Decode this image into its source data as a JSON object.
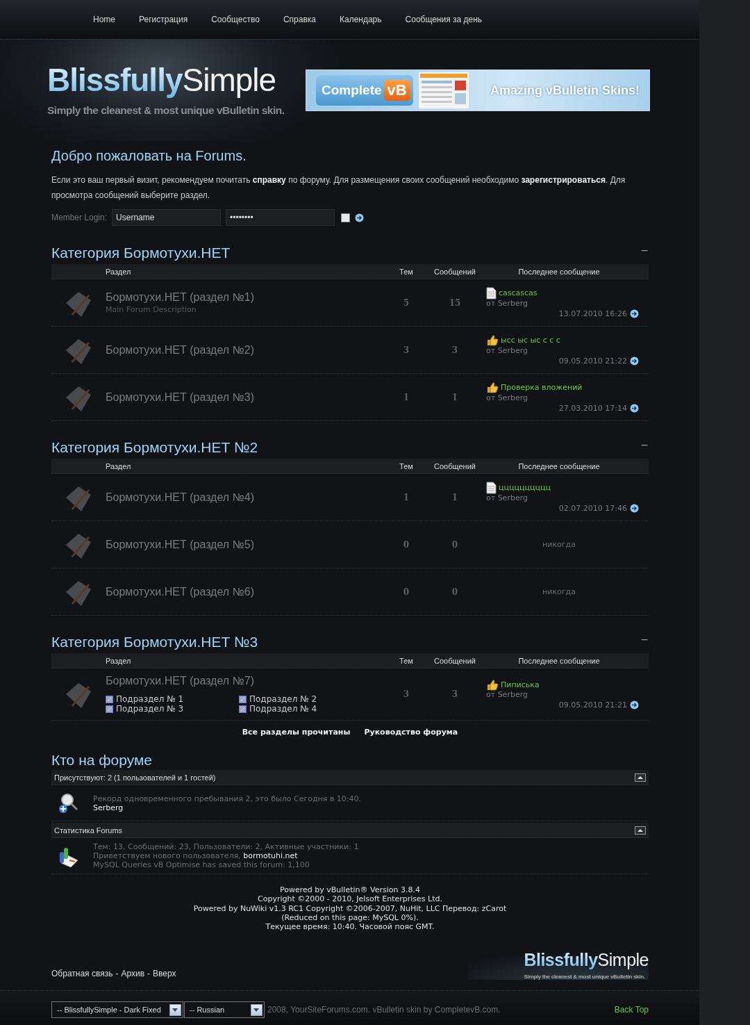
{
  "nav": [
    "Home",
    "Регистрация",
    "Сообщество",
    "Справка",
    "Календарь",
    "Сообщения за день"
  ],
  "logo": {
    "bold": "Blissfully",
    "light": "Simple",
    "tagline": "Simply the cleanest & most unique vBulletin skin."
  },
  "banner": {
    "left": "Complete",
    "badge": "vB",
    "right": "Amazing vBulletin Skins!"
  },
  "welcome": {
    "title": "Добро пожаловать на Forums.",
    "text": "Если это ваш первый визит, рекомендуем почитать **справку** по форуму. Для размещения своих сообщений необходимо **зарегистрироваться**. Для просмотра сообщений выберите раздел."
  },
  "login": {
    "label": "Member Login:",
    "username": "Username",
    "password": "••••••••",
    "remember": {
      "checked": false
    }
  },
  "categories": [
    {
      "title": "Категория Бормотухи.НЕТ",
      "collapse": "−",
      "columns": [
        "Раздел",
        "Тем",
        "Сообщений",
        "Последнее сообщение"
      ],
      "forums": [
        {
          "name": "Бормотухи.НЕТ (раздел №1)",
          "description": "Main Forum Description",
          "threads": "5",
          "posts": "15",
          "last_post": {
            "kind": "document",
            "title": "cascascas",
            "by": "от Serberg",
            "date": "13.07.2010 16:26"
          }
        },
        {
          "name": "Бормотухи.НЕТ (раздел №2)",
          "threads": "3",
          "posts": "3",
          "last_post": {
            "kind": "thumb",
            "title": "ысс ыс ыс с с с",
            "by": "от Serberg",
            "date": "09.05.2010 21:22"
          }
        },
        {
          "name": "Бормотухи.НЕТ (раздел №3)",
          "threads": "1",
          "posts": "1",
          "last_post": {
            "kind": "thumb",
            "title": "Проверка вложений",
            "by": "от Serberg",
            "date": "27.03.2010 17:14"
          }
        }
      ]
    },
    {
      "title": "Категория Бормотухи.НЕТ №2",
      "collapse": "−",
      "columns": [
        "Раздел",
        "Тем",
        "Сообщений",
        "Последнее сообщение"
      ],
      "forums": [
        {
          "name": "Бормотухи.НЕТ (раздел №4)",
          "threads": "1",
          "posts": "1",
          "last_post": {
            "kind": "document",
            "title": "цццццццццц",
            "by": "от Serberg",
            "date": "02.07.2010 17:46"
          }
        },
        {
          "name": "Бормотухи.НЕТ (раздел №5)",
          "threads": "0",
          "posts": "0",
          "last_post": {
            "kind": "never",
            "text": "никогда"
          }
        },
        {
          "name": "Бормотухи.НЕТ (раздел №6)",
          "threads": "0",
          "posts": "0",
          "last_post": {
            "kind": "never",
            "text": "никогда"
          }
        }
      ]
    },
    {
      "title": "Категория Бормотухи.НЕТ №3",
      "collapse": "−",
      "columns": [
        "Раздел",
        "Тем",
        "Сообщений",
        "Последнее сообщение"
      ],
      "forums": [
        {
          "name": "Бормотухи.НЕТ (раздел №7)",
          "subforums": [
            "Подраздел № 1",
            "Подраздел № 2",
            "Подраздел № 3",
            "Подраздел № 4"
          ],
          "threads": "3",
          "posts": "3",
          "last_post": {
            "kind": "thumb",
            "title": "Пиписька",
            "by": "от Serberg",
            "date": "09.05.2010 21:21"
          }
        }
      ]
    }
  ],
  "actions": [
    "Все разделы прочитаны",
    "Руководство форума"
  ],
  "who": {
    "title": "Кто на форуме",
    "sections": [
      {
        "kind": "online",
        "header": "Присутствуют: 2 (1 пользователей и 1 гостей)",
        "record": "Рекорд одновременного пребывания 2, это было Сегодня в 10:40.",
        "users": "Serberg"
      },
      {
        "kind": "stats",
        "header": "Статистика Forums",
        "totals": "Тем: 13, Сообщений: 23, Пользователи: 2, Активные участники: 1",
        "welcome": "Приветствуем нового пользователя,",
        "new_user": "bormotuhi.net",
        "extra": "MySQL Queries vB Optimise has saved this forum: 1,100"
      }
    ]
  },
  "credits": [
    "Powered by vBulletin® Version 3.8.4",
    "Copyright ©2000 - 2010, Jelsoft Enterprises Ltd.",
    "Powered by NuWiki v1.3 RC1 Copyright ©2006-2007, NuHit, LLC Перевод: zCarot",
    "(Reduced on this page: MySQL 0%).",
    "Текущее время: 10:40. Часовой пояс GMT."
  ],
  "footer_links": {
    "items": [
      "Обратная связь",
      "Архив",
      "Вверх"
    ],
    "separator": "-"
  },
  "footer_logo": {
    "bold": "Blissfully",
    "light": "Simple",
    "tagline": "Simply the cleanest & most unique vBulletin skin."
  },
  "bottom": {
    "style_select": "-- BlissfullySimple - Dark Fixed",
    "language_select": "-- Russian",
    "copyright": "2008, YourSiteForums.com. vBulletin skin by CompletevB.com.",
    "back_top": "Back Top"
  }
}
